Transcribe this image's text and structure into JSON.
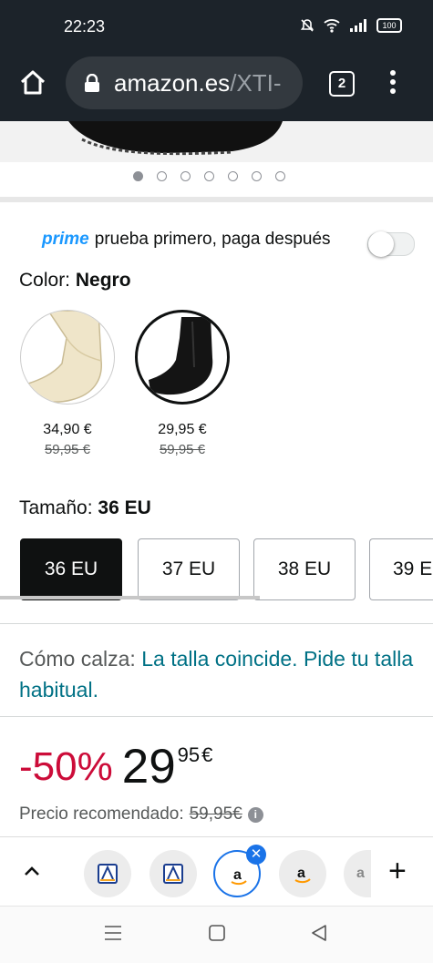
{
  "status_bar": {
    "time": "22:23",
    "battery": "100"
  },
  "browser": {
    "url_domain": "amazon.es",
    "url_path": "/XTI-",
    "tab_count": "2"
  },
  "gallery": {
    "image_count": 7,
    "active_index": 0
  },
  "prime": {
    "badge": "prime",
    "text": "prueba primero, paga después",
    "toggle_on": false
  },
  "color": {
    "label": "Color: ",
    "selected": "Negro",
    "options": [
      {
        "name": "beige-boot",
        "price": "34,90 €",
        "old_price": "59,95 €"
      },
      {
        "name": "black-boot",
        "price": "29,95 €",
        "old_price": "59,95 €"
      }
    ]
  },
  "size": {
    "label": "Tamaño: ",
    "selected": "36 EU",
    "options": [
      "36 EU",
      "37 EU",
      "38 EU",
      "39 E"
    ]
  },
  "fit": {
    "label": "Cómo calza: ",
    "value": "La talla coincide. Pide tu talla habitual."
  },
  "deal": {
    "discount": "-50%",
    "price_int": "29",
    "price_dec": "95",
    "currency": "€"
  },
  "recommended": {
    "label": "Precio recomendado:",
    "price": "59,95€"
  },
  "colors": {
    "accent": "#1a73e8",
    "deal_red": "#cc0c39",
    "link_teal": "#007185",
    "prime_blue": "#1a98ff"
  }
}
